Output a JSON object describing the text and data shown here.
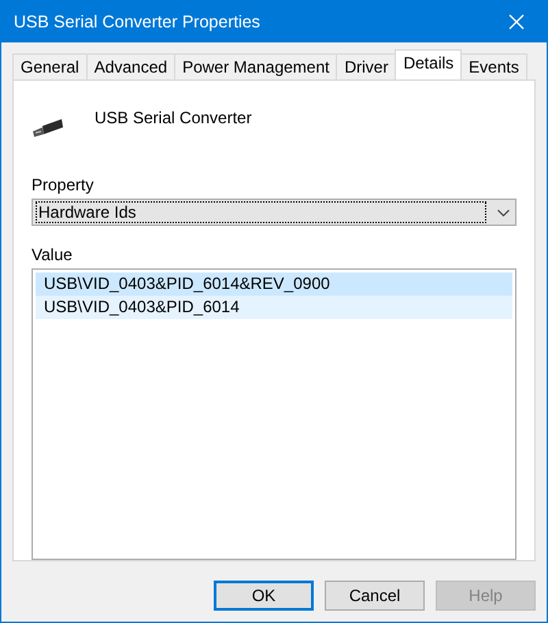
{
  "window": {
    "title": "USB Serial Converter Properties"
  },
  "tabs": [
    {
      "label": "General",
      "selected": false
    },
    {
      "label": "Advanced",
      "selected": false
    },
    {
      "label": "Power Management",
      "selected": false
    },
    {
      "label": "Driver",
      "selected": false
    },
    {
      "label": "Details",
      "selected": true
    },
    {
      "label": "Events",
      "selected": false
    }
  ],
  "device": {
    "name": "USB Serial Converter"
  },
  "property": {
    "label": "Property",
    "value": "Hardware Ids"
  },
  "value_list": {
    "label": "Value",
    "items": [
      {
        "text": "USB\\VID_0403&PID_6014&REV_0900",
        "selected": true,
        "hovered": false
      },
      {
        "text": "USB\\VID_0403&PID_6014",
        "selected": false,
        "hovered": true
      }
    ]
  },
  "buttons": [
    {
      "label": "OK",
      "default": true,
      "disabled": false
    },
    {
      "label": "Cancel",
      "default": false,
      "disabled": false
    },
    {
      "label": "Help",
      "default": false,
      "disabled": true
    }
  ]
}
